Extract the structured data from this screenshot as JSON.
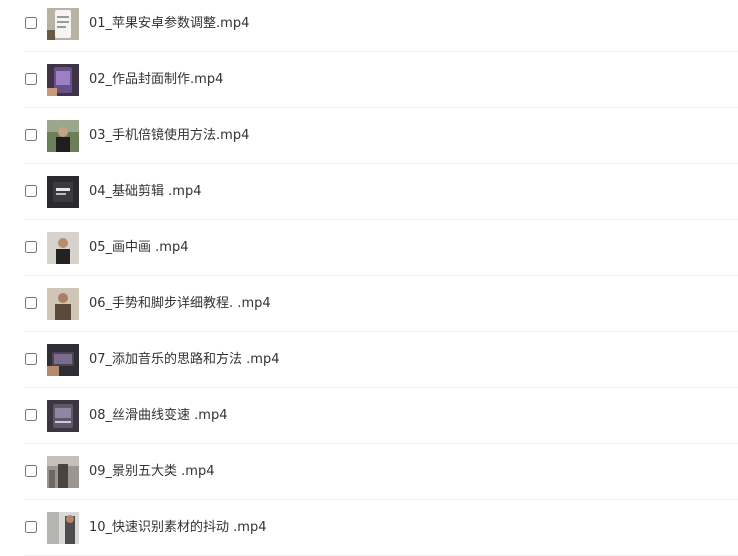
{
  "files": [
    {
      "name": "01_苹果安卓参数调整.mp4",
      "thumbnail_icon": "video-thumbnail"
    },
    {
      "name": "02_作品封面制作.mp4",
      "thumbnail_icon": "video-thumbnail"
    },
    {
      "name": "03_手机倍镜使用方法.mp4",
      "thumbnail_icon": "video-thumbnail"
    },
    {
      "name": "04_基础剪辑 .mp4",
      "thumbnail_icon": "video-thumbnail"
    },
    {
      "name": "05_画中画 .mp4",
      "thumbnail_icon": "video-thumbnail"
    },
    {
      "name": "06_手势和脚步详细教程. .mp4",
      "thumbnail_icon": "video-thumbnail"
    },
    {
      "name": "07_添加音乐的思路和方法 .mp4",
      "thumbnail_icon": "video-thumbnail"
    },
    {
      "name": "08_丝滑曲线变速 .mp4",
      "thumbnail_icon": "video-thumbnail"
    },
    {
      "name": "09_景别五大类 .mp4",
      "thumbnail_icon": "video-thumbnail"
    },
    {
      "name": "10_快速识别素材的抖动 .mp4",
      "thumbnail_icon": "video-thumbnail"
    }
  ],
  "colors": {
    "text": "#333333",
    "divider": "#eeeeee",
    "checkbox_border": "#cccccc"
  }
}
